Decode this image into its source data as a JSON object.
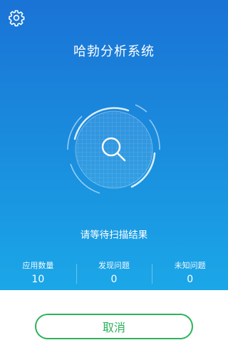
{
  "header": {
    "settings_icon": "gear-icon",
    "title": "哈勃分析系统"
  },
  "scanner": {
    "icon": "search-icon"
  },
  "status_text": "请等待扫描结果",
  "stats": [
    {
      "label": "应用数量",
      "value": "10"
    },
    {
      "label": "发现问题",
      "value": "0"
    },
    {
      "label": "未知问题",
      "value": "0"
    }
  ],
  "cancel_label": "取消",
  "colors": {
    "gradient_top": "#1a73d6",
    "gradient_bottom": "#1ba7e8",
    "accent_green": "#2cb35a"
  }
}
